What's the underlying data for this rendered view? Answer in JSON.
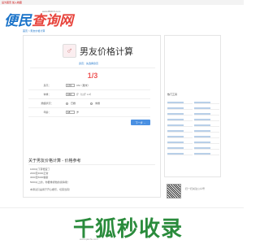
{
  "topbar": {
    "text": "设为首页 加入收藏"
  },
  "header": {
    "logo_main": "便民",
    "logo_accent": "查询网",
    "logo_url": "www.BMCX.com"
  },
  "breadcrumb": "首页 > 男友价格计算",
  "main": {
    "title": "男友价格计算",
    "subtitle": "身高：先选择身高",
    "step": "1/3",
    "fields": [
      {
        "label": "身高：",
        "value": "170",
        "unit": "CM（厘米）"
      },
      {
        "label": "体重：",
        "value": "160",
        "unit": "斤（公斤 x 2）"
      },
      {
        "label": "婚姻状况：",
        "option1": "已婚",
        "option2": "未婚"
      },
      {
        "label": "年龄：",
        "value": "18",
        "unit": "岁"
      }
    ],
    "next_button": "下一步 →",
    "section_title": "关于男友价格计算 - 价格参考",
    "references": [
      "1000以下算便宜了",
      "2000至3000正常",
      "3000至5000偏贵",
      "5000以上的，你要重视他的感情哦！"
    ],
    "note": "本测试只是用于开心娱乐，切莫当真！"
  },
  "sidebar": {
    "title": "热门工具"
  },
  "qr": {
    "text": "扫一扫关注公众号"
  },
  "footer": {
    "watermark": "千狐秒收录",
    "credit": "www.qianhu.com"
  },
  "colors": {
    "accent": "#1a73c9",
    "highlight": "#e55555",
    "button": "#4a90e2",
    "watermark": "#2a8b3c"
  }
}
